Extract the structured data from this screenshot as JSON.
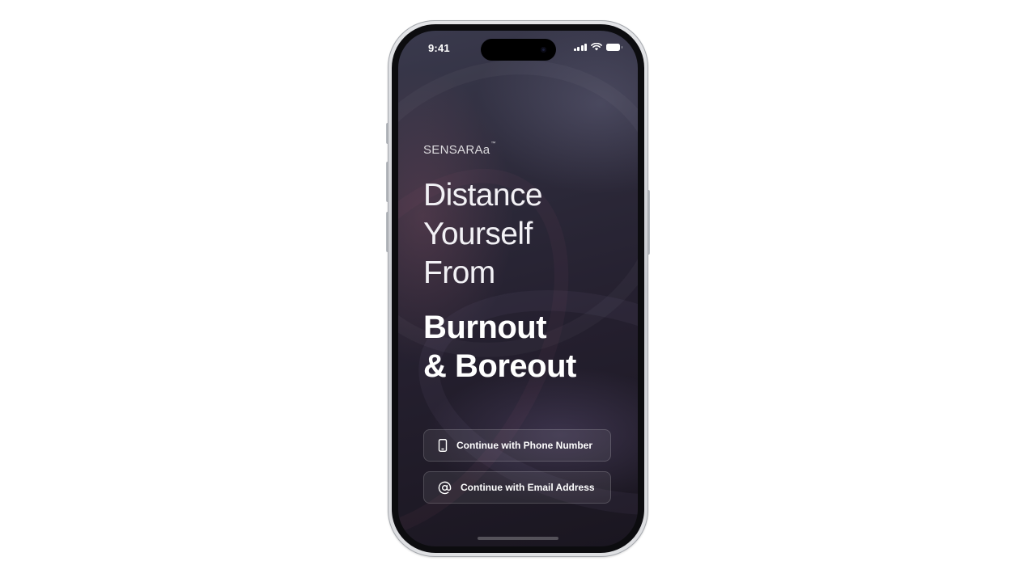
{
  "status_bar": {
    "time": "9:41"
  },
  "app": {
    "brand": "SENSARAa",
    "brand_mark": "™"
  },
  "hero": {
    "line1": "Distance",
    "line2": "Yourself",
    "line3": "From",
    "strong_line1": "Burnout",
    "strong_line2": "& Boreout"
  },
  "actions": {
    "phone_label": "Continue with Phone Number",
    "email_label": "Continue with Email Address"
  },
  "colors": {
    "background": "#ffffff",
    "screen_dark": "#241f2e",
    "text": "#ffffff"
  },
  "icons": {
    "phone": "smartphone-icon",
    "email": "at-sign-icon"
  }
}
